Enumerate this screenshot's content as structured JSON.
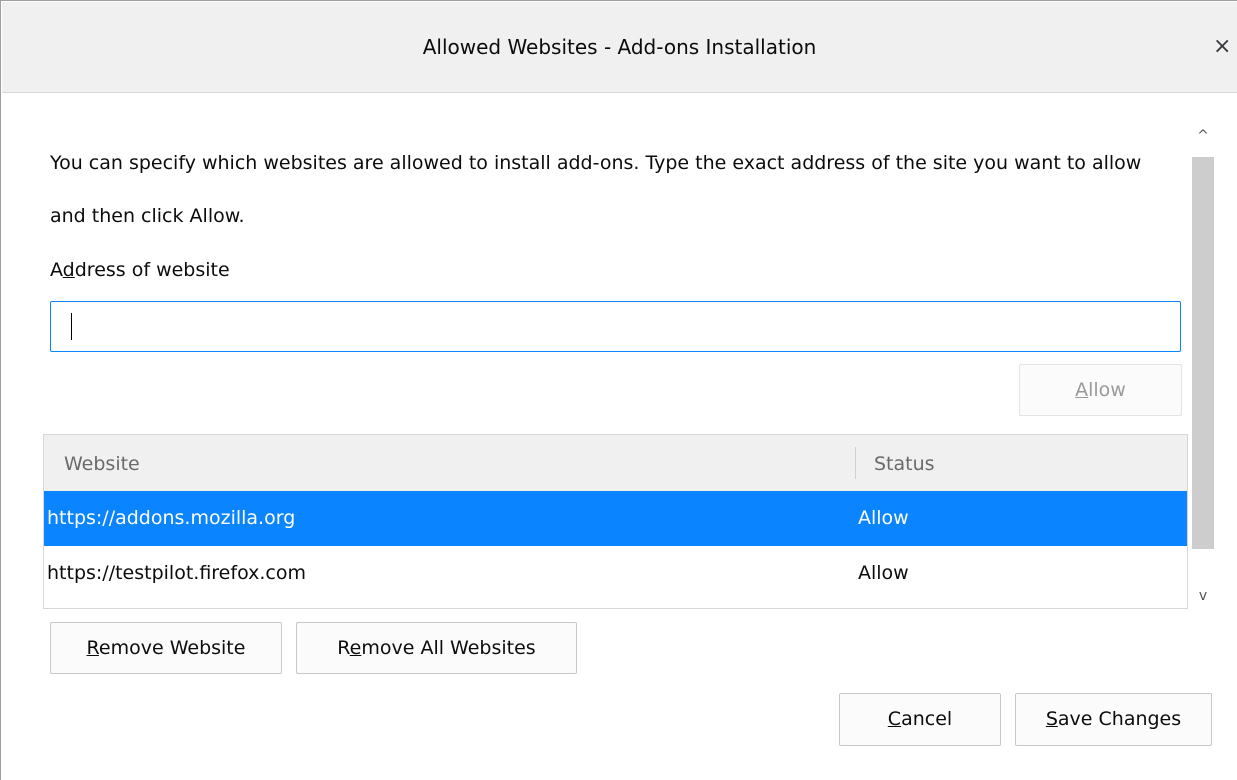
{
  "dialog": {
    "title": "Allowed Websites - Add-ons Installation",
    "close_glyph": "×"
  },
  "description": "You can specify which websites are allowed to install add-ons. Type the exact address of the site you want to allow and then click Allow.",
  "address": {
    "label_pre": "A",
    "label_accel": "d",
    "label_post": "dress of website",
    "value": ""
  },
  "allow_button": {
    "accel": "A",
    "rest": "llow"
  },
  "table": {
    "headers": {
      "website": "Website",
      "status": "Status"
    },
    "rows": [
      {
        "website": "https://addons.mozilla.org",
        "status": "Allow",
        "selected": true
      },
      {
        "website": "https://testpilot.firefox.com",
        "status": "Allow",
        "selected": false
      }
    ]
  },
  "buttons": {
    "remove": {
      "accel": "R",
      "rest": "emove Website"
    },
    "remove_all": {
      "pre": "R",
      "accel": "e",
      "rest": "move All Websites"
    },
    "cancel": {
      "accel": "C",
      "rest": "ancel"
    },
    "save": {
      "accel": "S",
      "rest": "ave Changes"
    }
  },
  "scrollbar": {
    "up_glyph": "^",
    "down_glyph": "v"
  },
  "colors": {
    "accent": "#0a84ff",
    "selection_text": "#ffffff"
  }
}
